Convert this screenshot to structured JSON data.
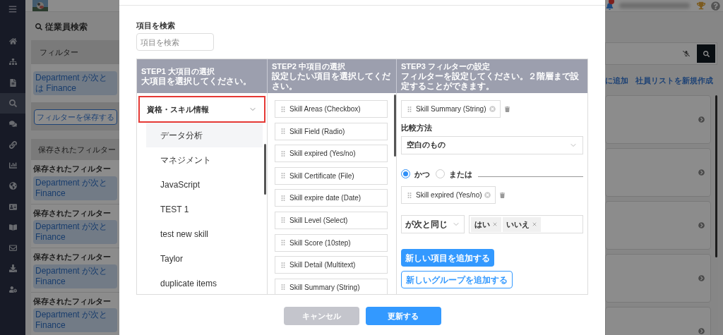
{
  "sidebar": {
    "items": [
      {
        "selected": false
      },
      {
        "selected": false
      },
      {
        "selected": false
      },
      {
        "selected": true
      },
      {
        "selected": false
      },
      {
        "selected": false
      },
      {
        "selected": false
      },
      {
        "selected": false
      },
      {
        "selected": false
      },
      {
        "selected": false
      },
      {
        "selected": false
      },
      {
        "selected": false
      },
      {
        "selected": false
      }
    ]
  },
  "page": {
    "title": "従業員検索",
    "filter_panel": {
      "title": "フィルター",
      "chip": [
        "Department が次と",
        "は Finance"
      ],
      "save_button": "フィルターを保存する"
    },
    "saved_filters": {
      "title": "保存されたフィルター",
      "items": [
        {
          "name": "保存されたフィルター",
          "chip": [
            "Department が次と",
            "Finance"
          ]
        },
        {
          "name": "保存されたフィルター",
          "chip": [
            "Department が次と",
            "Finance"
          ]
        },
        {
          "name": "保存されたフィルター",
          "chip": [
            "Department が次と",
            "Finance"
          ]
        },
        {
          "name": "保存されたフィルター",
          "chip": [
            "Department が次と",
            "Finance"
          ]
        }
      ]
    },
    "links": [
      "に追加",
      "社員リストを新規作成"
    ],
    "results": [
      {
        "kind": "card"
      },
      {
        "kind": "card"
      },
      {
        "kind": "card"
      },
      {
        "kind": "card"
      },
      {
        "kind": "card"
      }
    ]
  },
  "modal": {
    "search": {
      "label": "項目を検索",
      "placeholder": "項目を検索"
    },
    "steps": [
      {
        "title": "STEP1 大項目の選択",
        "subtitle": "大項目を選択してください。"
      },
      {
        "title": "STEP2 中項目の選択",
        "subtitle": "設定したい項目を選択してください。"
      },
      {
        "title": "STEP3 フィルターの設定",
        "subtitle": "フィルターを設定してください。２階層まで設定することができます。"
      }
    ],
    "categories": [
      {
        "label": "資格・スキル情報",
        "expanded": true,
        "children": [
          {
            "label": "データ分析",
            "selected": true
          },
          {
            "label": "マネジメント",
            "selected": false
          },
          {
            "label": "JavaScript",
            "selected": false
          },
          {
            "label": "TEST 1",
            "selected": false
          },
          {
            "label": "test new skill",
            "selected": false
          },
          {
            "label": "Taylor",
            "selected": false
          },
          {
            "label": "duplicate items",
            "selected": false
          }
        ]
      }
    ],
    "fields": [
      "Skill Areas (Checkbox)",
      "Skill Field (Radio)",
      "Skill expired (Yes/no)",
      "Skill Certificate (File)",
      "Skill expire date (Date)",
      "Skill Level (Select)",
      "Skill Score (10step)",
      "Skill Detail (Multitext)",
      "Skill Summary (String)"
    ],
    "filter_items": [
      {
        "kind": "condition",
        "field": "Skill Summary (String)",
        "label": "比較方法",
        "operator": "空白のもの"
      },
      {
        "kind": "connector",
        "options": [
          {
            "label": "かつ",
            "selected": true
          },
          {
            "label": "または",
            "selected": false
          }
        ]
      },
      {
        "kind": "condition",
        "field": "Skill expired (Yes/no)",
        "operator": "が次と同じ",
        "values": [
          "はい",
          "いいえ"
        ]
      }
    ],
    "actions": [
      {
        "label": "新しい項目を追加する",
        "kind": "primary"
      },
      {
        "label": "新しいグループを追加する",
        "kind": "outline"
      }
    ],
    "footer": [
      {
        "label": "キャンセル",
        "kind": "secondary"
      },
      {
        "label": "更新する",
        "kind": "primary"
      }
    ]
  }
}
